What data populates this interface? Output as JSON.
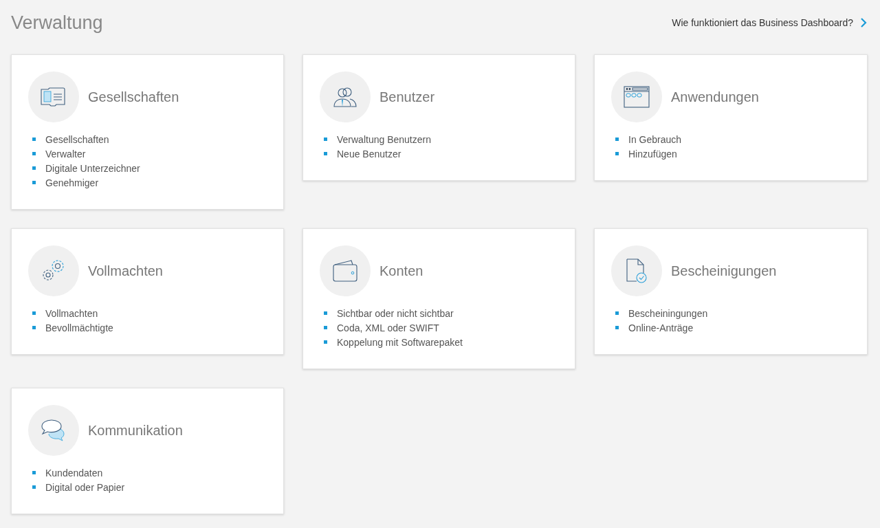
{
  "page": {
    "title": "Verwaltung",
    "help_link": "Wie funktioniert das Business Dashboard?"
  },
  "cards": [
    {
      "kind": "company",
      "title": "Gesellschaften",
      "items": [
        "Gesellschaften",
        "Verwalter",
        "Digitale Unterzeichner",
        "Genehmiger"
      ]
    },
    {
      "kind": "users",
      "title": "Benutzer",
      "items": [
        "Verwaltung Benutzern",
        "Neue Benutzer"
      ]
    },
    {
      "kind": "apps",
      "title": "Anwendungen",
      "items": [
        "In Gebrauch",
        "Hinzufügen"
      ]
    },
    {
      "kind": "gears",
      "title": "Vollmachten",
      "items": [
        "Vollmachten",
        "Bevollmächtigte"
      ]
    },
    {
      "kind": "wallet",
      "title": "Konten",
      "items": [
        "Sichtbar oder nicht sichtbar",
        "Coda, XML oder SWIFT",
        "Koppelung mit Softwarepaket"
      ]
    },
    {
      "kind": "certificate",
      "title": "Bescheinigungen",
      "items": [
        "Bescheiningungen",
        "Online-Anträge"
      ]
    },
    {
      "kind": "chat",
      "title": "Kommunikation",
      "items": [
        "Kundendaten",
        "Digital oder Papier"
      ]
    }
  ]
}
